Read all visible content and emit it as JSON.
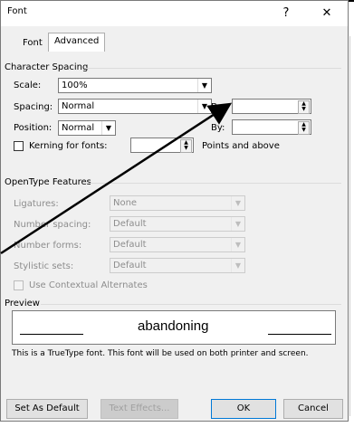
{
  "window": {
    "title": "Font",
    "help_label": "?",
    "close_label": "✕"
  },
  "tabs": [
    {
      "label": "Font"
    },
    {
      "label": "Advanced"
    }
  ],
  "character_spacing": {
    "group_label": "Character Spacing",
    "scale": {
      "label": "Scale:",
      "value": "100%"
    },
    "spacing": {
      "label": "Spacing:",
      "value": "Normal"
    },
    "spacing_by": {
      "label": "By:",
      "value": ""
    },
    "position": {
      "label": "Position:",
      "value": "Normal"
    },
    "position_by": {
      "label": "By:",
      "value": ""
    },
    "kerning": {
      "label": "Kerning for fonts:",
      "value": "",
      "suffix": "Points and above",
      "checked": false
    }
  },
  "opentype": {
    "group_label": "OpenType Features",
    "ligatures": {
      "label": "Ligatures:",
      "value": "None"
    },
    "number_spacing": {
      "label": "Number spacing:",
      "value": "Default"
    },
    "number_forms": {
      "label": "Number forms:",
      "value": "Default"
    },
    "stylistic_sets": {
      "label": "Stylistic sets:",
      "value": "Default"
    },
    "contextual_alternates": {
      "label": "Use Contextual Alternates",
      "checked": false
    }
  },
  "preview": {
    "group_label": "Preview",
    "sample_text": "abandoning",
    "note": "This is a TrueType font. This font will be used on both printer and screen."
  },
  "buttons": {
    "set_default": "Set As Default",
    "text_effects": "Text Effects...",
    "ok": "OK",
    "cancel": "Cancel"
  }
}
